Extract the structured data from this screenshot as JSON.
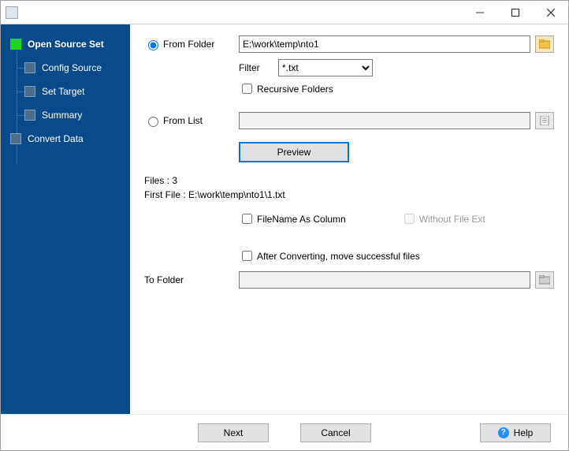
{
  "titlebar": {
    "title": ""
  },
  "sidebar": {
    "items": [
      {
        "label": "Open Source Set",
        "active": true
      },
      {
        "label": "Config Source"
      },
      {
        "label": "Set Target"
      },
      {
        "label": "Summary"
      },
      {
        "label": "Convert Data"
      }
    ]
  },
  "source": {
    "from_folder_label": "From Folder",
    "from_folder_selected": true,
    "folder_path": "E:\\work\\temp\\nto1",
    "filter_label": "Filter",
    "filter_value": "*.txt",
    "filter_options": [
      "*.txt"
    ],
    "recursive_label": "Recursive Folders",
    "recursive_checked": false,
    "from_list_label": "From List",
    "from_list_selected": false,
    "list_path": "",
    "preview_label": "Preview"
  },
  "status": {
    "files_label": "Files : 3",
    "first_file_label": "First File : E:\\work\\temp\\nto1\\1.txt"
  },
  "options": {
    "filename_col_label": "FileName As Column",
    "filename_col_checked": false,
    "without_ext_label": "Without File Ext",
    "without_ext_checked": false,
    "after_convert_label": "After Converting, move successful files",
    "after_convert_checked": false,
    "to_folder_label": "To Folder",
    "to_folder_path": ""
  },
  "footer": {
    "next": "Next",
    "cancel": "Cancel",
    "help": "Help"
  }
}
